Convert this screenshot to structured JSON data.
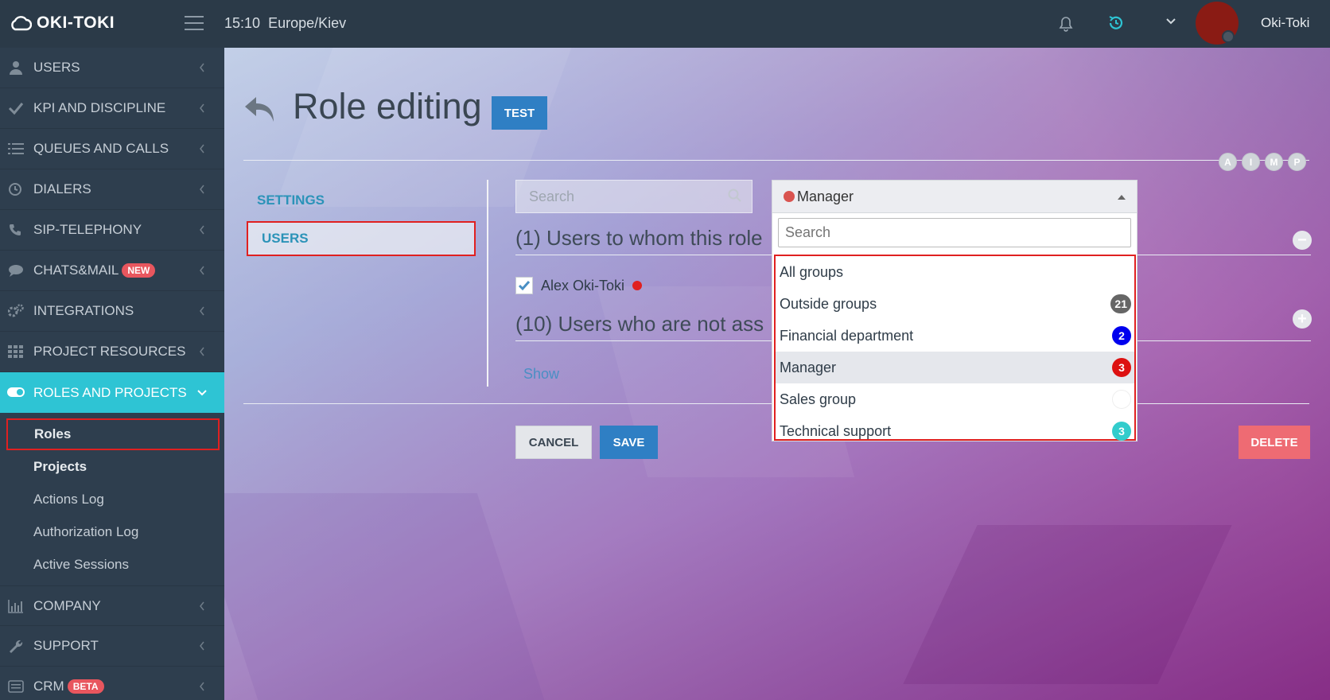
{
  "topbar": {
    "logo_text": "OKI-TOKI",
    "time": "15:10",
    "timezone": "Europe/Kiev",
    "username": "Oki-Toki"
  },
  "sidebar": {
    "items": [
      {
        "label": "USERS",
        "icon": "user-icon"
      },
      {
        "label": "KPI AND DISCIPLINE",
        "icon": "check-icon"
      },
      {
        "label": "QUEUES AND CALLS",
        "icon": "list-icon"
      },
      {
        "label": "DIALERS",
        "icon": "clock-icon"
      },
      {
        "label": "SIP-TELEPHONY",
        "icon": "phone-icon"
      },
      {
        "label": "CHATS&MAIL",
        "icon": "chat-icon",
        "badge": "NEW"
      },
      {
        "label": "INTEGRATIONS",
        "icon": "gears-icon"
      },
      {
        "label": "PROJECT RESOURCES",
        "icon": "grid-icon"
      },
      {
        "label": "ROLES AND PROJECTS",
        "icon": "toggle-icon"
      }
    ],
    "subitems": [
      "Roles",
      "Projects",
      "Actions Log",
      "Authorization Log",
      "Active Sessions"
    ],
    "bottom_items": [
      {
        "label": "COMPANY",
        "icon": "bar-chart-icon"
      },
      {
        "label": "SUPPORT",
        "icon": "wrench-icon"
      },
      {
        "label": "CRM",
        "icon": "crm-icon",
        "badge": "BETA"
      }
    ]
  },
  "main": {
    "title": "Role editing",
    "role_badge": "TEST",
    "circle_buttons": [
      "A",
      "I",
      "M",
      "P"
    ],
    "tabs": [
      "SETTINGS",
      "USERS"
    ],
    "search_placeholder": "Search",
    "section1": "(1) Users to whom this role",
    "user_name": "Alex Oki-Toki",
    "section2": "(10) Users who are not ass",
    "show_link": "Show",
    "cancel": "CANCEL",
    "save": "SAVE",
    "delete": "DELETE"
  },
  "dropdown": {
    "selected": "Manager",
    "search_placeholder": "Search",
    "options": [
      {
        "label": "All groups",
        "count": "",
        "color": ""
      },
      {
        "label": "Outside groups",
        "count": "21",
        "color": "#666666"
      },
      {
        "label": "Financial department",
        "count": "2",
        "color": "#0000ee"
      },
      {
        "label": "Manager",
        "count": "3",
        "color": "#dd1111"
      },
      {
        "label": "Sales group",
        "count": "",
        "color": "#ffffff"
      },
      {
        "label": "Technical support",
        "count": "3",
        "color": "#33cccc"
      }
    ]
  },
  "colors": {
    "accent": "#2ec4d4",
    "primary_button": "#2f7fc4",
    "delete_button": "#ee6b73",
    "highlight_box": "#e02020"
  }
}
